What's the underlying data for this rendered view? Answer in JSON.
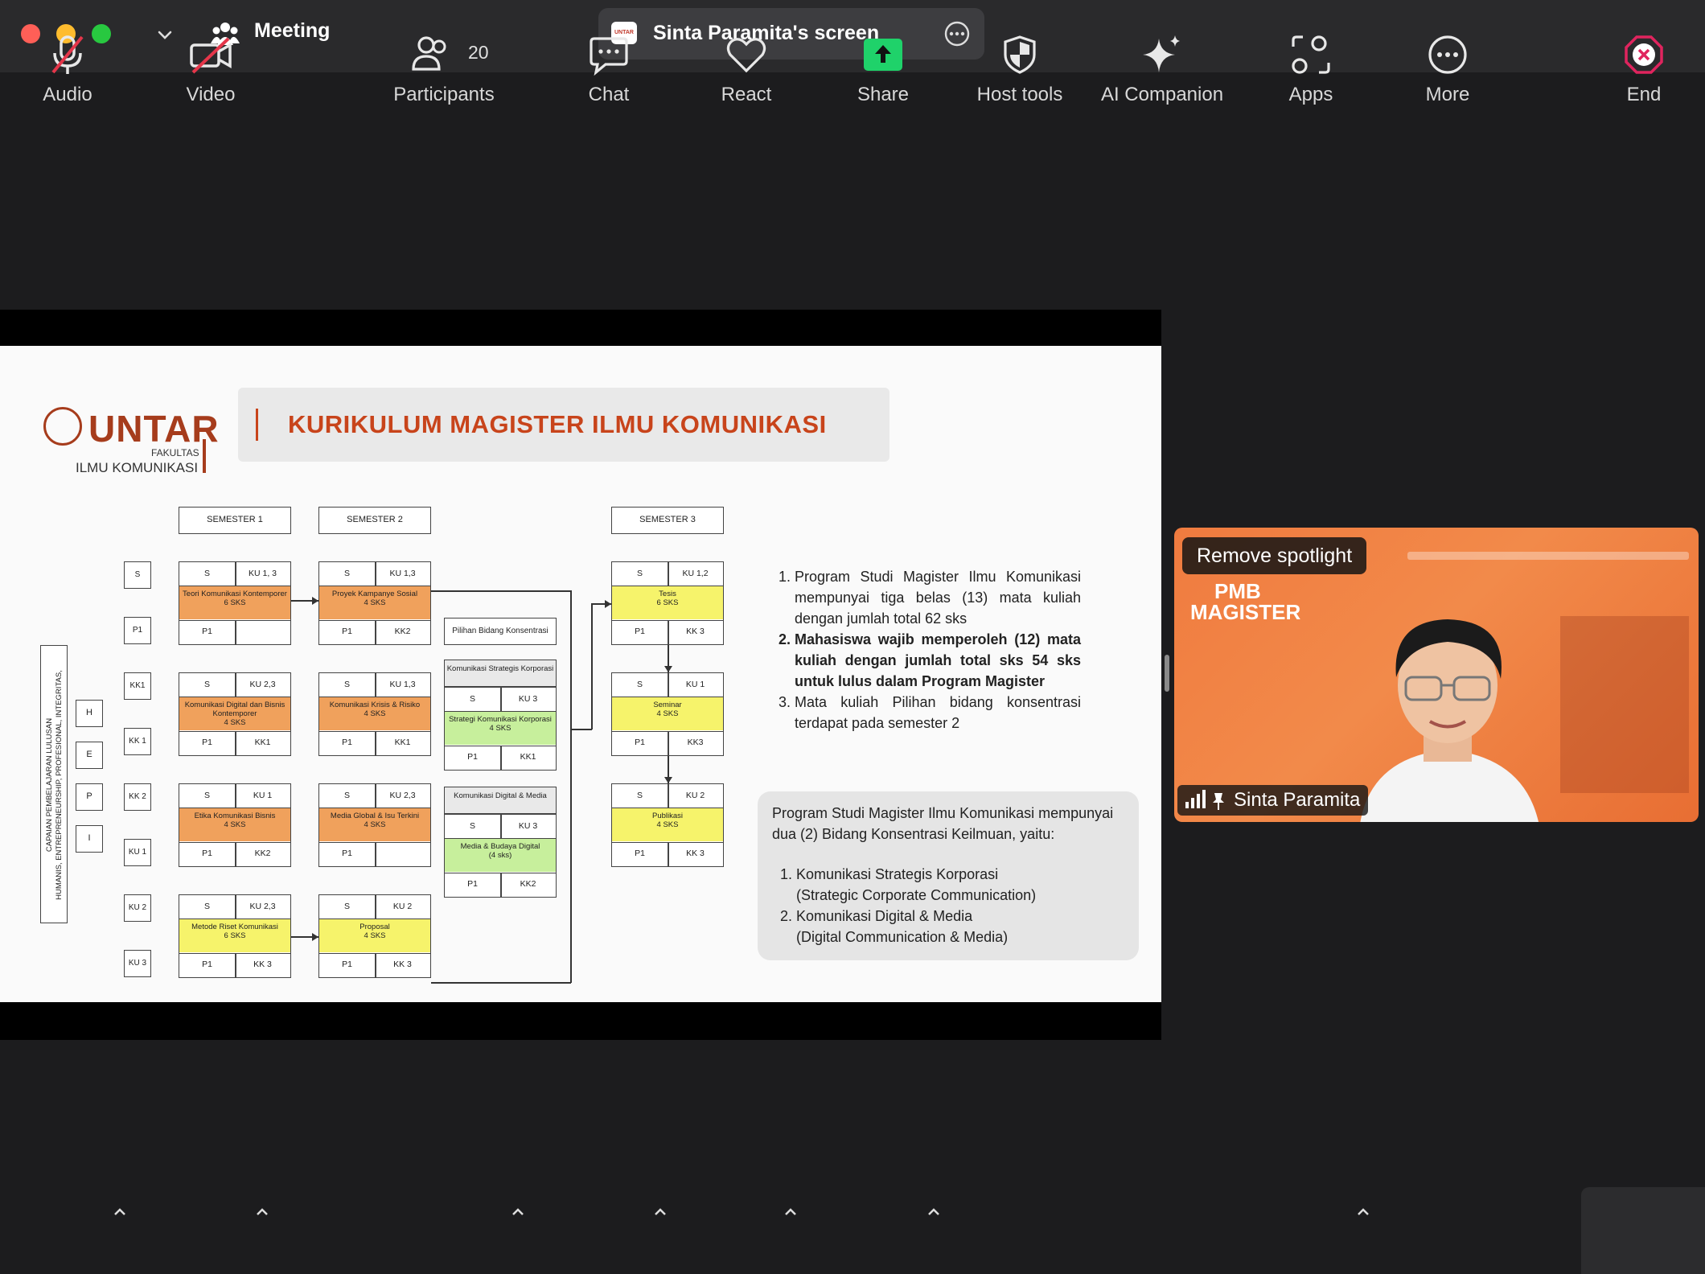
{
  "window": {
    "meeting_label": "Meeting",
    "share_title": "Sinta Paramita's screen",
    "share_logo_text": "UNTAR"
  },
  "slide": {
    "logo": {
      "name": "UNTAR",
      "faculty_small": "FAKULTAS",
      "faculty": "ILMU KOMUNIKASI"
    },
    "title": "KURIKULUM MAGISTER ILMU KOMUNIKASI",
    "semesters": [
      "SEMESTER 1",
      "SEMESTER 2",
      "SEMESTER 3"
    ],
    "side_labels": [
      "S",
      "P1",
      "KK1",
      "KK 1",
      "KK 2",
      "KU 1",
      "KU 2",
      "KU 3"
    ],
    "hepi": [
      "H",
      "E",
      "P",
      "I"
    ],
    "vertical_text_1": "CAPAIAN PEMBELAJARAN LULUSAN",
    "vertical_text_2": "HUMANIS, ENTREPRENEURSHIP, PROFESIONAL, INTEGRITAS,",
    "concentration_header": "Pilihan Bidang Konsentrasi",
    "courses": {
      "s1_1": {
        "tl": "S",
        "tr": "KU 1, 3",
        "name": "Teori Komunikasi Kontemporer",
        "sks": "6 SKS",
        "bl": "P1",
        "br": ""
      },
      "s1_2": {
        "tl": "S",
        "tr": "KU 2,3",
        "name": "Komunikasi Digital dan Bisnis Kontemporer",
        "sks": "4 SKS",
        "bl": "P1",
        "br": "KK1"
      },
      "s1_3": {
        "tl": "S",
        "tr": "KU 1",
        "name": "Etika Komunikasi Bisnis",
        "sks": "4 SKS",
        "bl": "P1",
        "br": "KK2"
      },
      "s1_4": {
        "tl": "S",
        "tr": "KU 2,3",
        "name": "Metode Riset Komunikasi",
        "sks": "6 SKS",
        "bl": "P1",
        "br": "KK 3"
      },
      "s2_1": {
        "tl": "S",
        "tr": "KU 1,3",
        "name": "Proyek Kampanye Sosial",
        "sks": "4 SKS",
        "bl": "P1",
        "br": "KK2"
      },
      "s2_2": {
        "tl": "S",
        "tr": "KU 1,3",
        "name": "Komunikasi Krisis & Risiko",
        "sks": "4 SKS",
        "bl": "P1",
        "br": "KK1"
      },
      "s2_3": {
        "tl": "S",
        "tr": "KU 2,3",
        "name": "Media Global & Isu Terkini",
        "sks": "4 SKS",
        "bl": "P1",
        "br": ""
      },
      "s2_4": {
        "tl": "S",
        "tr": "KU 2",
        "name": "Proposal",
        "sks": "4 SKS",
        "bl": "P1",
        "br": "KK 3"
      },
      "k_1": {
        "head": "Komunikasi Strategis Korporasi",
        "tl": "S",
        "tr": "KU 3",
        "name": "Strategi Komunikasi Korporasi",
        "sks": "4 SKS",
        "bl": "P1",
        "br": "KK1"
      },
      "k_2": {
        "head": "Komunikasi Digital & Media",
        "tl": "S",
        "tr": "KU 3",
        "name": "Media & Budaya Digital",
        "sks": "(4 sks)",
        "bl": "P1",
        "br": "KK2"
      },
      "s3_1": {
        "tl": "S",
        "tr": "KU 1,2",
        "name": "Tesis",
        "sks": "6 SKS",
        "bl": "P1",
        "br": "KK 3"
      },
      "s3_2": {
        "tl": "S",
        "tr": "KU 1",
        "name": "Seminar",
        "sks": "4 SKS",
        "bl": "P1",
        "br": "KK3"
      },
      "s3_3": {
        "tl": "S",
        "tr": "KU 2",
        "name": "Publikasi",
        "sks": "4 SKS",
        "bl": "P1",
        "br": "KK 3"
      }
    },
    "notes": [
      "Program Studi Magister Ilmu Komunikasi mempunyai tiga belas (13) mata kuliah dengan jumlah total 62 sks",
      "Mahasiswa wajib memperoleh (12) mata kuliah dengan jumlah total sks 54 sks untuk lulus dalam Program Magister",
      "Mata kuliah Pilihan bidang konsentrasi terdapat pada semester 2"
    ],
    "info_intro": "Program Studi Magister Ilmu Komunikasi mempunyai dua (2) Bidang Konsentrasi Keilmuan, yaitu:",
    "info_items": [
      {
        "name": "Komunikasi Strategis Korporasi",
        "en": "(Strategic Corporate Communication)"
      },
      {
        "name": "Komunikasi Digital & Media",
        "en": "(Digital Communication & Media)"
      }
    ]
  },
  "video": {
    "remove_spotlight": "Remove spotlight",
    "participant_name": "Sinta Paramita",
    "background_title_1": "PMB",
    "background_title_2": "MAGISTER"
  },
  "toolbar": {
    "audio": "Audio",
    "video": "Video",
    "participants": "Participants",
    "participants_count": "20",
    "chat": "Chat",
    "react": "React",
    "share": "Share",
    "host_tools": "Host tools",
    "ai_companion": "AI Companion",
    "apps": "Apps",
    "more": "More",
    "end": "End"
  },
  "colors": {
    "accent_orange": "#c8441b",
    "share_green": "#1fd26a",
    "end_red": "#e0245e"
  }
}
